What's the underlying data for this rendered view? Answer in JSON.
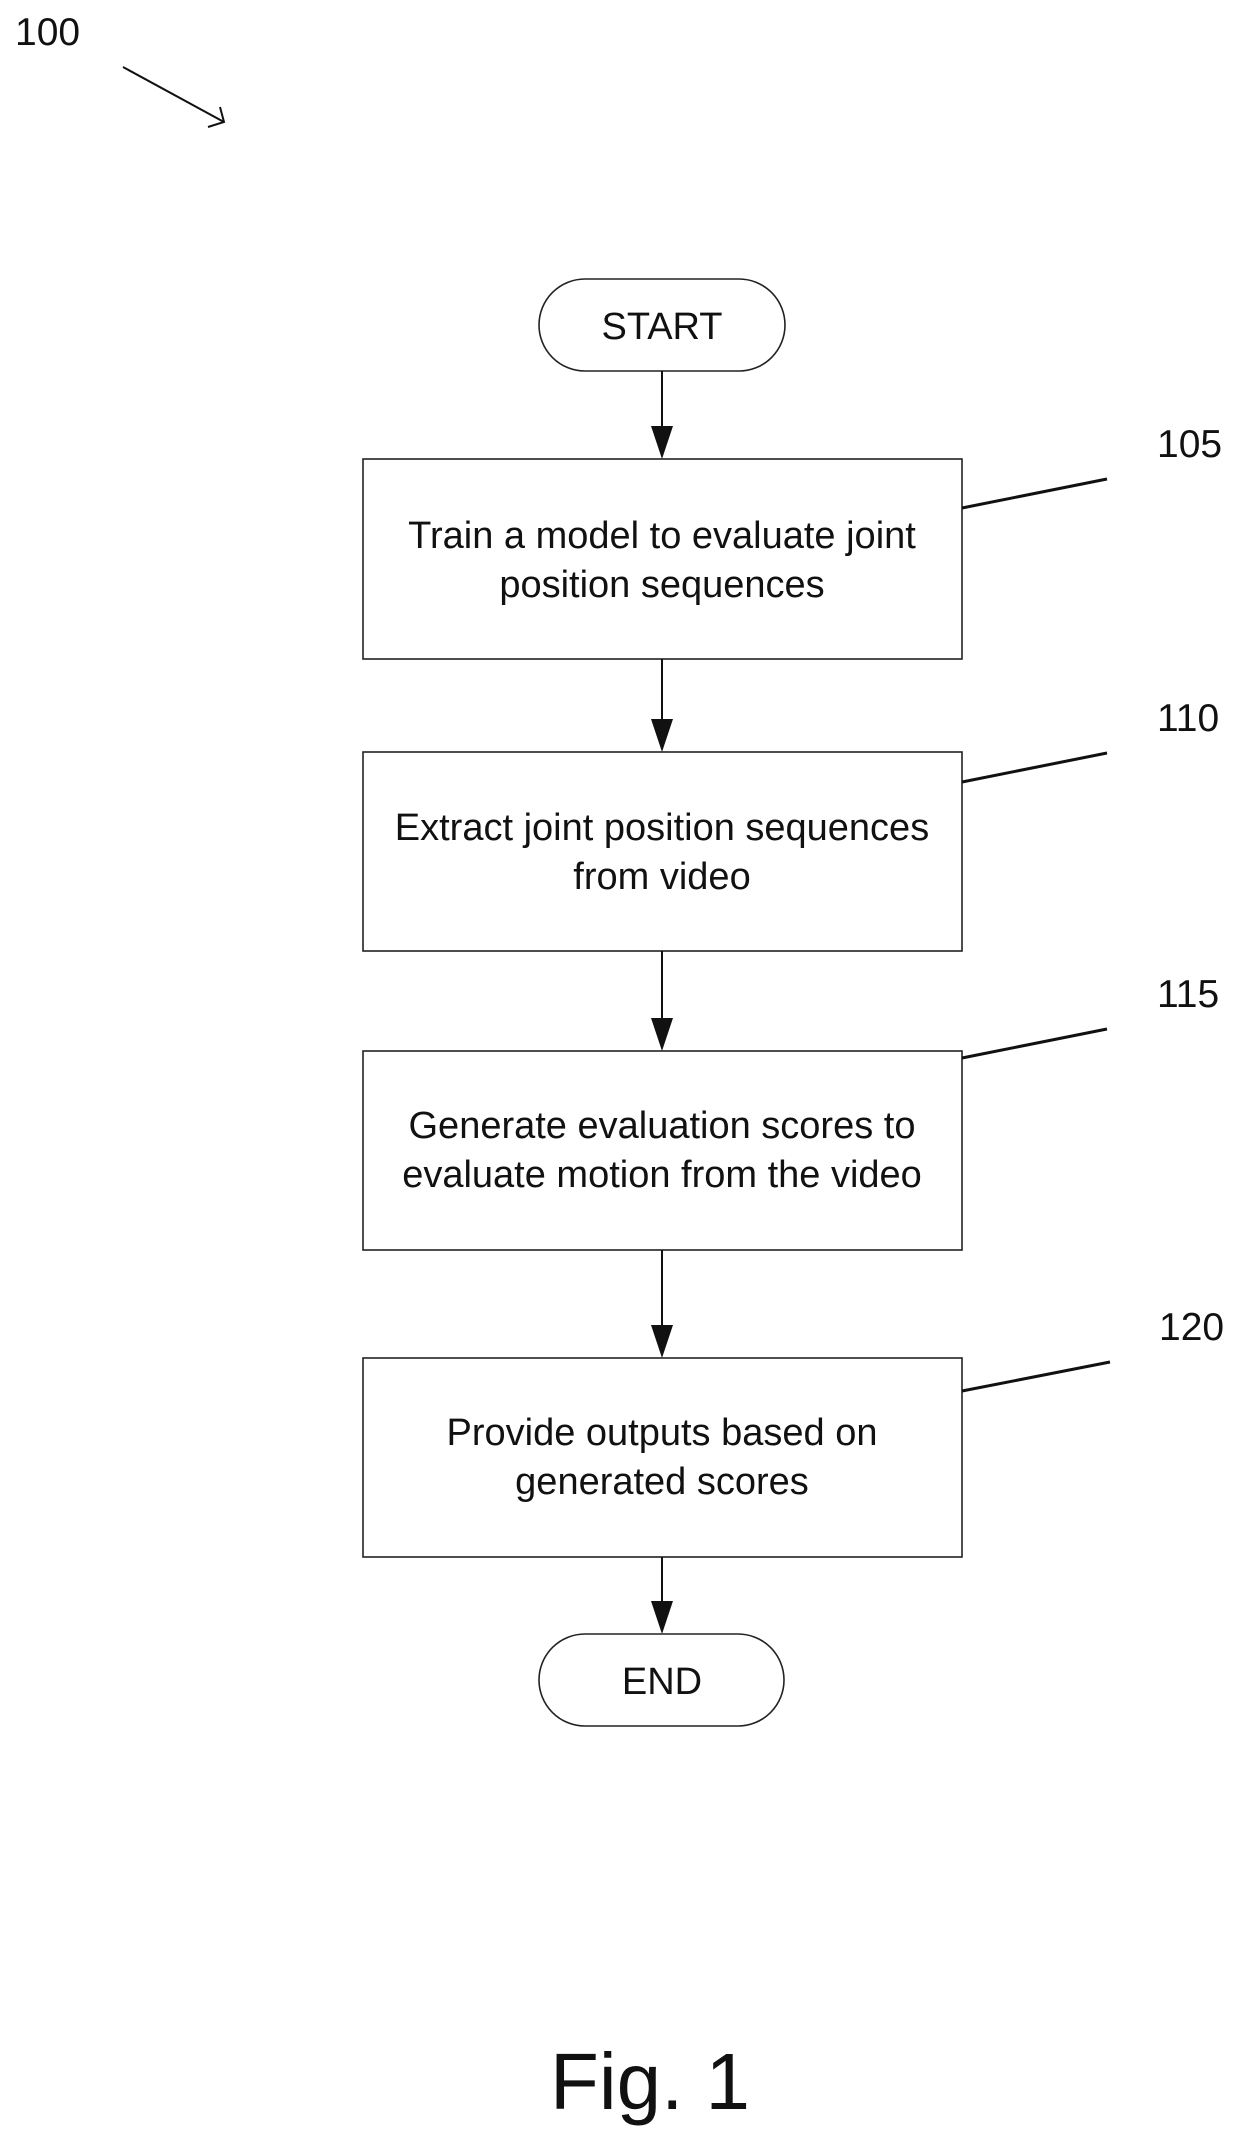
{
  "figure": {
    "ref_number": "100",
    "caption": "Fig. 1"
  },
  "flowchart": {
    "start_label": "START",
    "end_label": "END",
    "steps": [
      {
        "ref": "105",
        "lines": [
          "Train a model to evaluate joint",
          "position sequences"
        ]
      },
      {
        "ref": "110",
        "lines": [
          "Extract joint position sequences",
          "from video"
        ]
      },
      {
        "ref": "115",
        "lines": [
          "Generate evaluation scores to",
          "evaluate motion from the video"
        ]
      },
      {
        "ref": "120",
        "lines": [
          "Provide outputs based on",
          "generated scores"
        ]
      }
    ]
  },
  "colors": {
    "stroke": "#111111",
    "background": "#ffffff"
  }
}
